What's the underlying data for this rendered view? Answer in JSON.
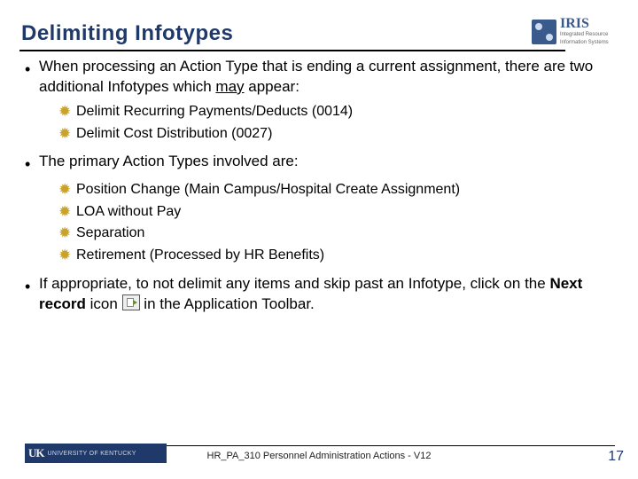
{
  "header": {
    "title": "Delimiting Infotypes",
    "logo_primary": "IRIS",
    "logo_sub1": "Integrated Resource",
    "logo_sub2": "Information Systems"
  },
  "body": {
    "bullet1_pre": "When processing an Action Type that is ending a current assignment, there are two additional Infotypes which ",
    "bullet1_underlined": "may",
    "bullet1_post": " appear:",
    "sub1": [
      "Delimit Recurring Payments/Deducts (0014)",
      "Delimit Cost Distribution (0027)"
    ],
    "bullet2": "The primary Action Types involved are:",
    "sub2": [
      "Position Change (Main Campus/Hospital Create Assignment)",
      "LOA without Pay",
      "Separation",
      "Retirement (Processed by HR Benefits)"
    ],
    "bullet3_pre": "If appropriate, to not delimit any items and skip past an Infotype, click on the ",
    "bullet3_bold": "Next record",
    "bullet3_mid": " icon ",
    "bullet3_post": " in the Application Toolbar."
  },
  "footer": {
    "uk_mark": "UK",
    "uk_text": "UNIVERSITY OF KENTUCKY",
    "center": "HR_PA_310 Personnel Administration Actions - V12",
    "page": "17"
  }
}
